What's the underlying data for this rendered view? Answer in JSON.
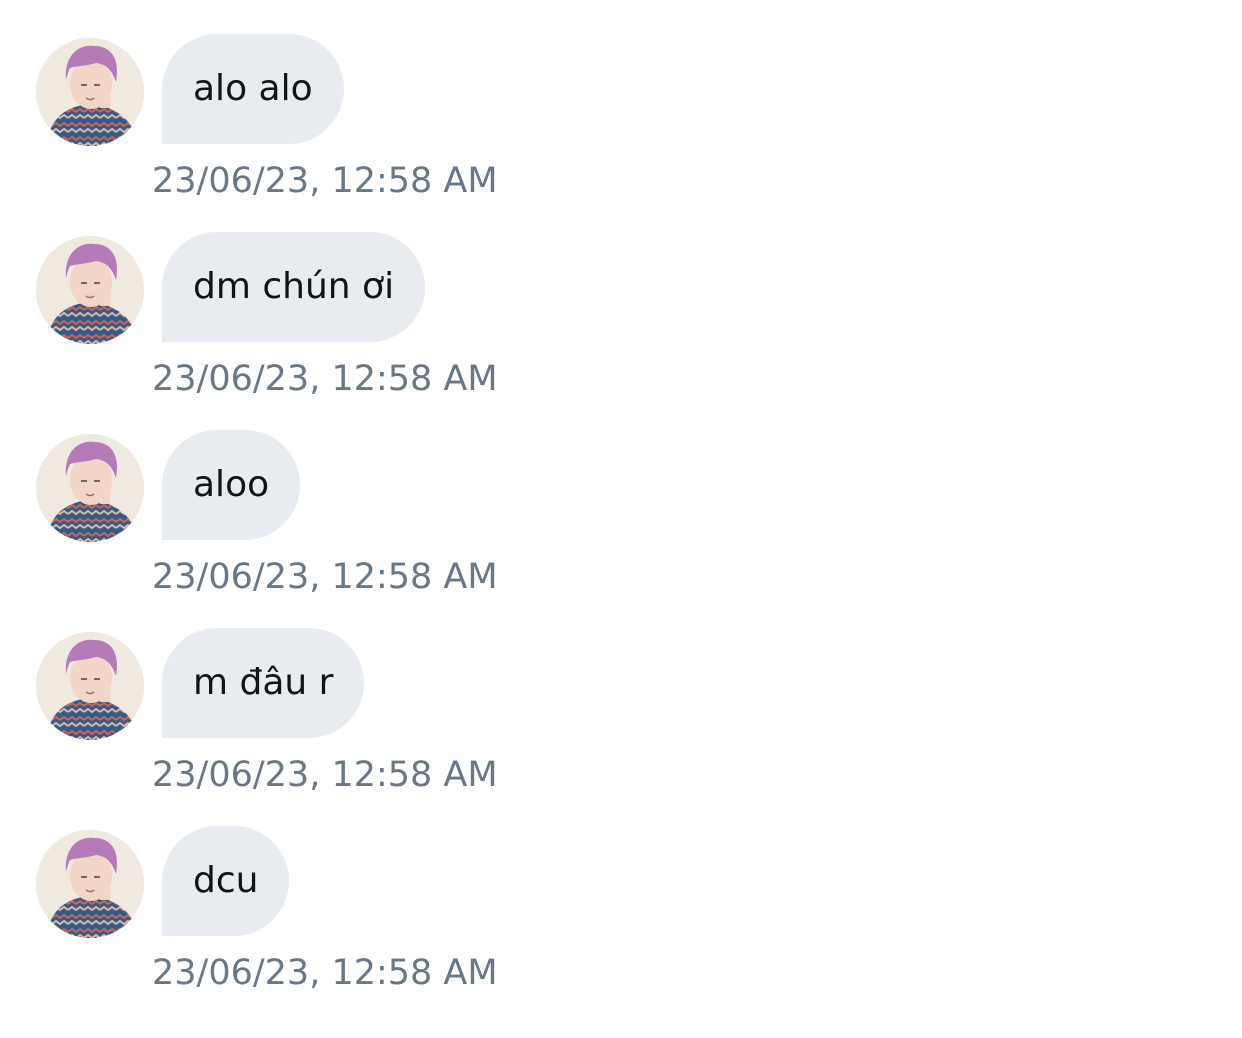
{
  "conversation": {
    "messages": [
      {
        "text": "alo alo",
        "timestamp": "23/06/23, 12:58 AM"
      },
      {
        "text": "dm chún ơi",
        "timestamp": "23/06/23, 12:58 AM"
      },
      {
        "text": "aloo",
        "timestamp": "23/06/23, 12:58 AM"
      },
      {
        "text": "m đâu r",
        "timestamp": "23/06/23, 12:58 AM"
      },
      {
        "text": "dcu",
        "timestamp": "23/06/23, 12:58 AM"
      }
    ]
  },
  "colors": {
    "bubble_background": "#e8ebef",
    "message_text": "#0f1419",
    "timestamp_text": "#697787",
    "page_background": "#ffffff"
  },
  "icons": {
    "avatar": "user-avatar-photo"
  }
}
